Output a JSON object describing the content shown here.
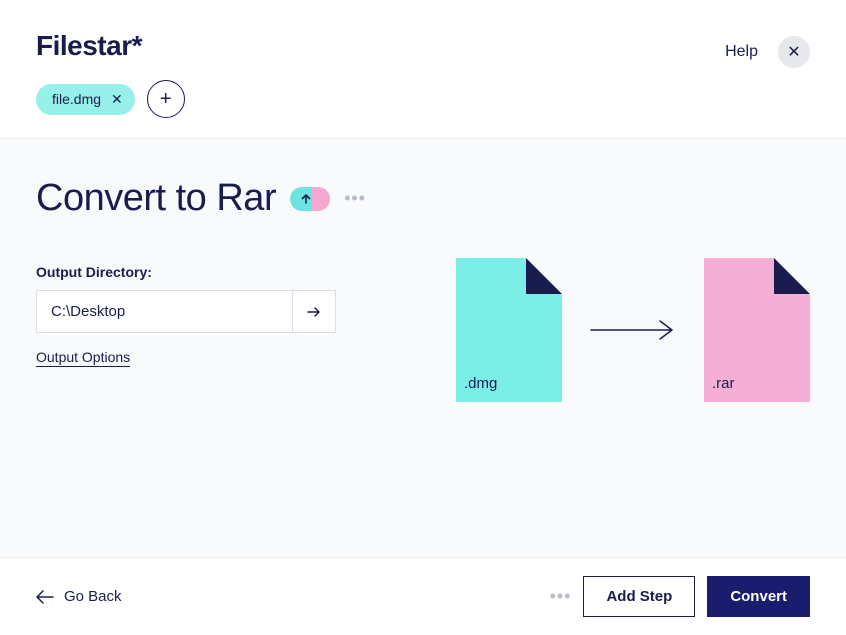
{
  "header": {
    "logo": "Filestar*",
    "file_chip": "file.dmg",
    "help": "Help"
  },
  "main": {
    "title": "Convert to Rar",
    "output_label": "Output Directory:",
    "output_path": "C:\\Desktop",
    "options_link": "Output Options",
    "src_ext": ".dmg",
    "dst_ext": ".rar"
  },
  "footer": {
    "go_back": "Go Back",
    "add_step": "Add Step",
    "convert": "Convert"
  }
}
